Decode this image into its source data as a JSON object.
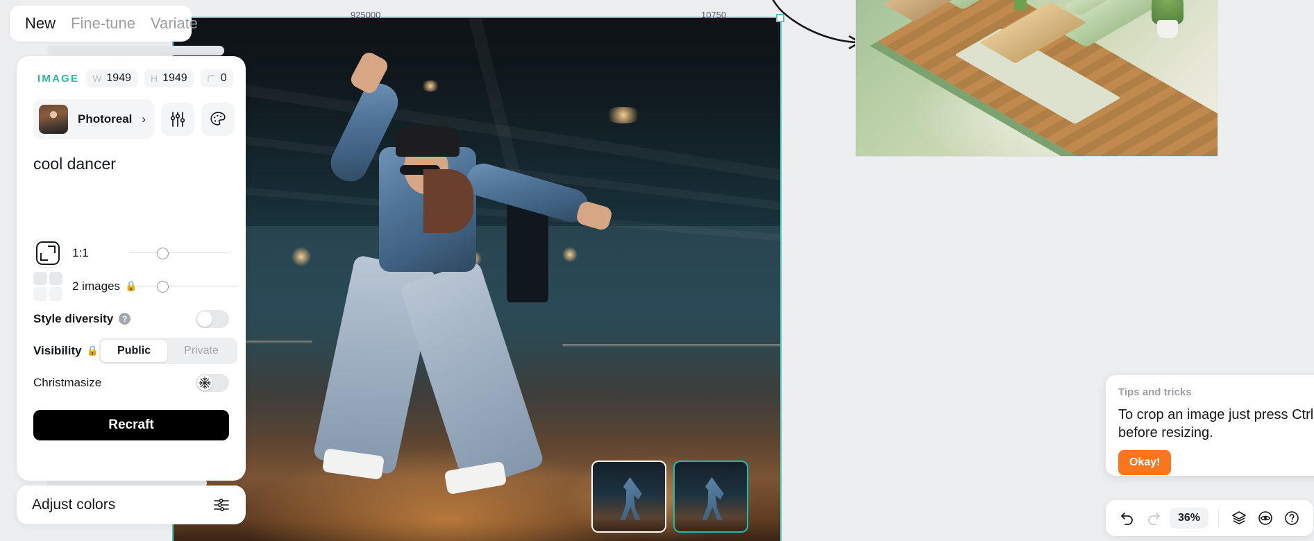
{
  "app": {
    "accent_teal": "#19bfae",
    "accent_green": "#2fb89c",
    "accent_orange": "#f9761d",
    "canvas_bg": "#eceef0"
  },
  "tabs": [
    {
      "label": "New",
      "active": true
    },
    {
      "label": "Fine-tune",
      "active": false
    },
    {
      "label": "Variate",
      "active": false
    }
  ],
  "meta": {
    "type_label": "IMAGE",
    "type_icon": "image-icon",
    "width_key": "W",
    "width_value": "1949",
    "height_key": "H",
    "height_value": "1949",
    "corner_key": "corner-radius-icon",
    "corner_value": "0"
  },
  "style": {
    "name": "Photoreal",
    "chevron": "›",
    "sliders_icon": "sliders-icon",
    "palette_icon": "palette-icon"
  },
  "prompt": {
    "text": "cool dancer"
  },
  "controls": {
    "aspect": {
      "icon": "aspect-ratio-icon",
      "label": "1:1",
      "slider_percent": 32
    },
    "count": {
      "icon": "grid-2x2-icon",
      "label": "2 images",
      "lock": "🔒",
      "slider_percent": 25
    },
    "style_diversity": {
      "label": "Style diversity",
      "help": "?",
      "on": false
    },
    "visibility": {
      "label": "Visibility",
      "lock": "🔒",
      "options": [
        {
          "label": "Public",
          "selected": true
        },
        {
          "label": "Private",
          "selected": false
        }
      ]
    },
    "christmasize": {
      "label": "Christmasize",
      "icon": "snowflake-icon",
      "on": false
    }
  },
  "actions": {
    "recraft_label": "Recraft"
  },
  "adjust": {
    "label": "Adjust colors",
    "icon": "color-sliders-icon"
  },
  "filmstrip": [
    {
      "name": "variant-1",
      "selected": false
    },
    {
      "name": "variant-2",
      "selected": true
    }
  ],
  "canvas_labels": {
    "top_left_number": "925000",
    "top_mid_number": "10750"
  },
  "tips": {
    "title": "Tips and tricks",
    "close": "✕",
    "body": "To crop an image just press Ctrl before resizing.",
    "cta": "Okay!"
  },
  "bottom_bar": {
    "undo_icon": "undo-icon",
    "redo_icon": "redo-icon",
    "zoom_level": "36%",
    "layers_icon": "layers-icon",
    "preview_icon": "eye-icon",
    "help_icon": "question-circle-icon"
  }
}
